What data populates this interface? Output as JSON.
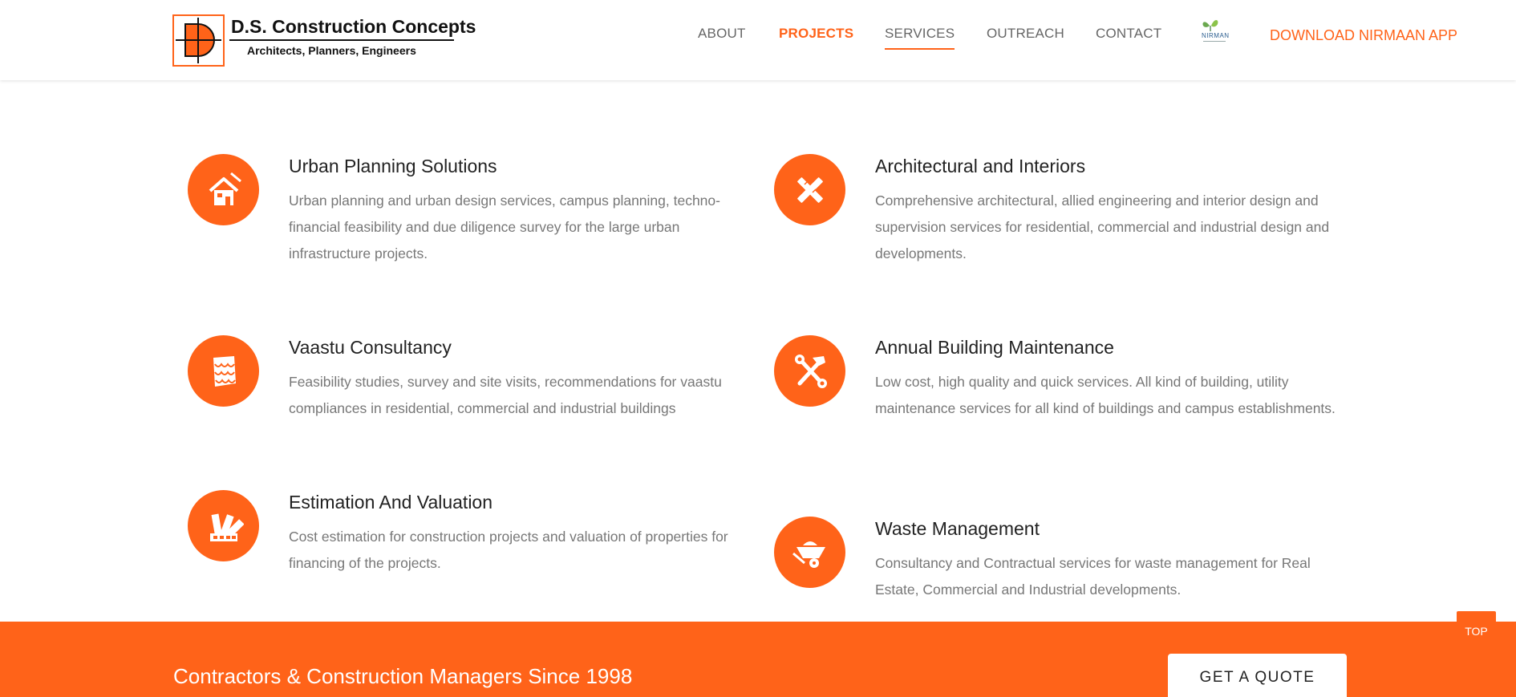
{
  "header": {
    "logo_title": "D.S. Construction Concepts",
    "logo_subtitle": "Architects, Planners, Engineers",
    "nav": [
      "ABOUT",
      "PROJECTS",
      "SERVICES",
      "OUTREACH",
      "CONTACT"
    ],
    "nirmaan_logo_text": "NIRMAN",
    "download_label": "DOWNLOAD NIRMAAN APP"
  },
  "services": [
    {
      "title": "Urban Planning Solutions",
      "description": "Urban planning and urban design services, campus planning, techno-financial feasibility and due diligence survey for the large urban infrastructure projects.",
      "icon": "house-icon"
    },
    {
      "title": "Architectural and Interiors",
      "description": "Comprehensive architectural, allied engineering and interior design and supervision services for residential, commercial and industrial design and developments.",
      "icon": "pencil-ruler-icon"
    },
    {
      "title": "Vaastu Consultancy",
      "description": "Feasibility studies, survey and site visits, recommendations for vaastu compliances in residential, commercial and industrial buildings",
      "icon": "roof-tiles-icon"
    },
    {
      "title": "Annual Building Maintenance",
      "description": "Low cost, high quality and quick services. All kind of building, utility maintenance services for all kind of buildings and campus establishments.",
      "icon": "hammer-wrench-icon"
    },
    {
      "title": "Estimation And Valuation",
      "description": "Cost estimation for construction projects and valuation of properties for financing of the projects.",
      "icon": "color-swatch-icon"
    },
    {
      "title": "Waste Management",
      "description": "Consultancy and Contractual services for waste management for Real Estate, Commercial and Industrial developments.",
      "icon": "wheelbarrow-icon"
    }
  ],
  "footer_band": {
    "tagline": "Contractors & Construction Managers Since 1998",
    "quote_button": "GET A QUOTE"
  },
  "top_button": "TOP",
  "colors": {
    "accent": "#ff6319",
    "text_dark": "#222222",
    "text_muted": "#777777"
  }
}
